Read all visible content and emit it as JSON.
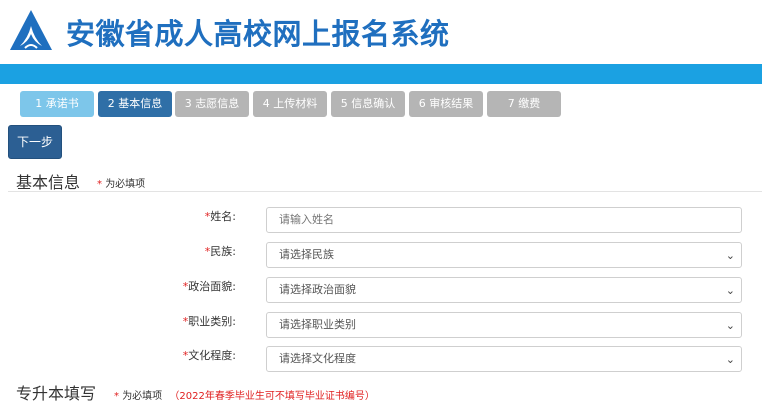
{
  "header": {
    "title": "安徽省成人高校网上报名系统"
  },
  "steps": [
    {
      "label": "1 承诺书",
      "state": "done"
    },
    {
      "label": "2 基本信息",
      "state": "active"
    },
    {
      "label": "3 志愿信息",
      "state": "todo"
    },
    {
      "label": "4 上传材料",
      "state": "todo"
    },
    {
      "label": "5 信息确认",
      "state": "todo"
    },
    {
      "label": "6 审核结果",
      "state": "todo"
    },
    {
      "label": "7 缴费",
      "state": "todo"
    }
  ],
  "next_button": "下一步",
  "section_basic": {
    "title": "基本信息",
    "star": "*",
    "note": "为必填项"
  },
  "fields": [
    {
      "star": "*",
      "label": "姓名:",
      "type": "text",
      "placeholder": "请输入姓名"
    },
    {
      "star": "*",
      "label": "民族:",
      "type": "select",
      "value": "请选择民族"
    },
    {
      "star": "*",
      "label": "政治面貌:",
      "type": "select",
      "value": "请选择政治面貌"
    },
    {
      "star": "*",
      "label": "职业类别:",
      "type": "select",
      "value": "请选择职业类别"
    },
    {
      "star": "*",
      "label": "文化程度:",
      "type": "select",
      "value": "请选择文化程度"
    }
  ],
  "section_upgrade": {
    "title": "专升本填写",
    "star": "*",
    "note": "为必填项",
    "warning": "（2022年春季毕业生可不填写毕业证书编号）"
  },
  "colors": {
    "brand": "#1f6fbf",
    "band": "#1ba1e2",
    "active_step": "#2f6fa7",
    "required": "#e02020"
  }
}
